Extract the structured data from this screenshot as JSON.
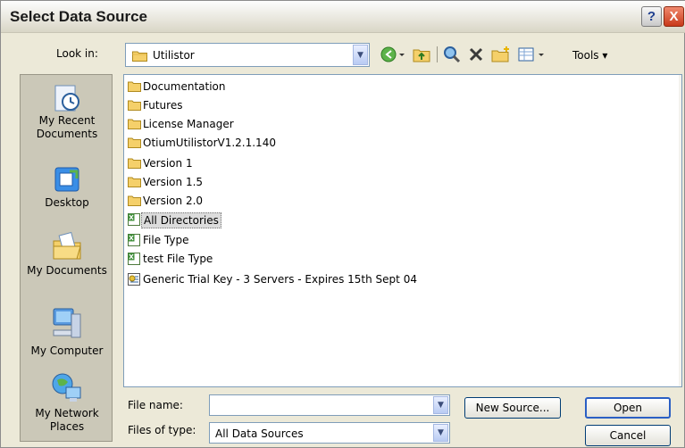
{
  "dialog": {
    "title": "Select Data Source",
    "help_glyph": "?",
    "close_glyph": "X"
  },
  "look_in": {
    "label": "Look in:",
    "value": "Utilistor"
  },
  "toolbar": {
    "tools_label": "Tools",
    "icons": [
      "back-icon",
      "up-folder-icon",
      "search-web-icon",
      "delete-icon",
      "new-folder-icon",
      "views-icon"
    ]
  },
  "places": [
    {
      "label": "My Recent Documents",
      "icon": "recent-documents-icon"
    },
    {
      "label": "Desktop",
      "icon": "desktop-icon"
    },
    {
      "label": "My Documents",
      "icon": "my-documents-icon"
    },
    {
      "label": "My Computer",
      "icon": "my-computer-icon"
    },
    {
      "label": "My Network Places",
      "icon": "network-places-icon"
    }
  ],
  "files": [
    {
      "name": "Documentation",
      "type": "folder"
    },
    {
      "name": "Futures",
      "type": "folder"
    },
    {
      "name": "License Manager",
      "type": "folder"
    },
    {
      "name": "OtiumUtilistorV1.2.1.140",
      "type": "folder"
    },
    {
      "name": "Version 1",
      "type": "folder"
    },
    {
      "name": "Version 1.5",
      "type": "folder"
    },
    {
      "name": "Version 2.0",
      "type": "folder"
    },
    {
      "name": "All Directories",
      "type": "excel",
      "selected": true
    },
    {
      "name": "File Type",
      "type": "excel"
    },
    {
      "name": "test File Type",
      "type": "excel"
    },
    {
      "name": "Generic Trial Key - 3 Servers - Expires 15th Sept 04",
      "type": "certificate"
    }
  ],
  "file_name": {
    "label": "File name:",
    "value": ""
  },
  "file_type": {
    "label": "Files of type:",
    "value": "All Data Sources"
  },
  "buttons": {
    "new_source": "New Source...",
    "open": "Open",
    "cancel": "Cancel"
  },
  "colors": {
    "close_button": "#c8391a",
    "places_bar": "#cbc8b8",
    "dialog_bg": "#ece9d8",
    "field_border": "#7f9db9"
  }
}
